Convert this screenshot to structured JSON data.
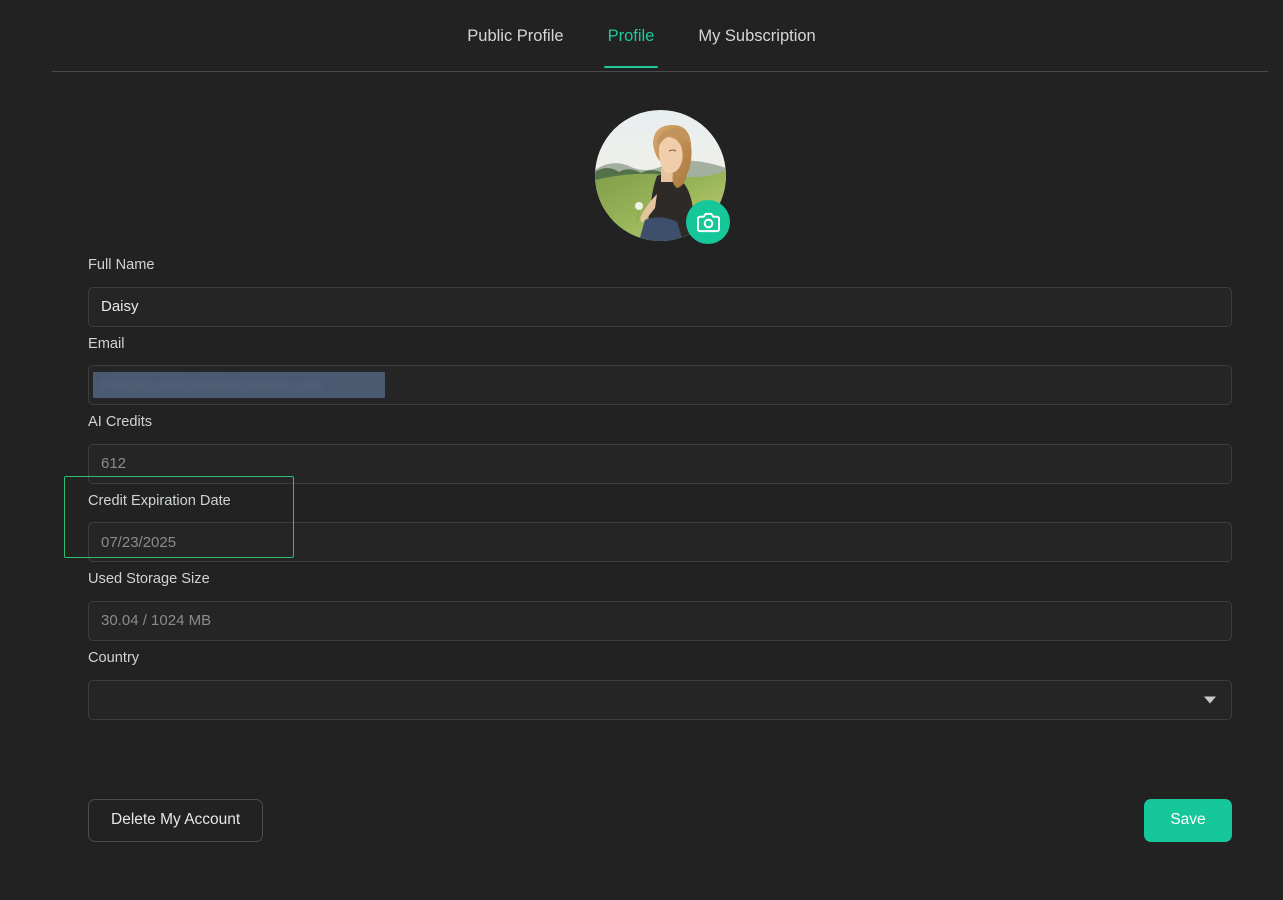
{
  "theme": {
    "background": "#222222",
    "accent": "#16c79a",
    "tab_active": "#1fc99a",
    "highlight_border": "#2fbd70",
    "selection": "#4a5a71",
    "input_bg": "#252525",
    "input_border": "#3d3d3d",
    "label_color": "#cfd3d6",
    "placeholder_color": "#8b8b8b"
  },
  "tabs": [
    {
      "label": "Public Profile",
      "active": false
    },
    {
      "label": "Profile",
      "active": true
    },
    {
      "label": "My Subscription",
      "active": false
    }
  ],
  "avatar": {
    "alt": "profile-photo-woman-in-field",
    "upload_icon": "camera-icon"
  },
  "form": {
    "full_name": {
      "label": "Full Name",
      "value": "Daisy",
      "placeholder": ""
    },
    "email": {
      "label": "Email",
      "value": "hangnguyen@atomisystems.com",
      "placeholder": "",
      "selected": true
    },
    "ai_credits": {
      "label": "AI Credits",
      "value": "",
      "placeholder": "612"
    },
    "credit_expiration_date": {
      "label": "Credit Expiration Date",
      "value": "",
      "placeholder": "07/23/2025",
      "highlighted": true
    },
    "used_storage_size": {
      "label": "Used Storage Size",
      "value": "",
      "placeholder": "30.04 / 1024 MB"
    },
    "country": {
      "label": "Country",
      "value": "",
      "placeholder": "",
      "dropdown_icon": "chevron-down-icon"
    }
  },
  "actions": {
    "delete_label": "Delete My Account",
    "save_label": "Save"
  }
}
